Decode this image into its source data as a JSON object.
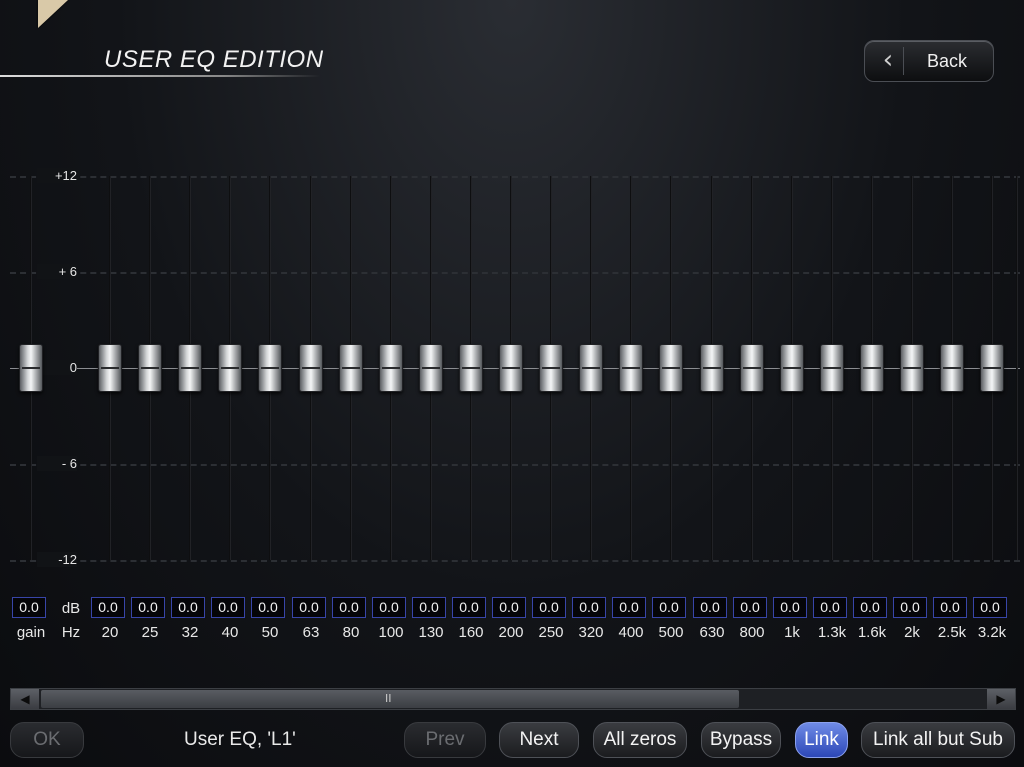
{
  "header": {
    "title": "USER EQ EDITION",
    "back_label": "Back",
    "back_icon": "chevron-left-icon"
  },
  "scale": {
    "unit": "dB",
    "range_db": [
      -12,
      12
    ],
    "labels": [
      "+12",
      "+ 6",
      "0",
      "- 6",
      "-12"
    ]
  },
  "gain": {
    "value": "0.0",
    "label": "gain",
    "level_db": 0
  },
  "freq_unit": "Hz",
  "bands": [
    {
      "freq": "20",
      "value": "0.0",
      "level_db": 0
    },
    {
      "freq": "25",
      "value": "0.0",
      "level_db": 0
    },
    {
      "freq": "32",
      "value": "0.0",
      "level_db": 0
    },
    {
      "freq": "40",
      "value": "0.0",
      "level_db": 0
    },
    {
      "freq": "50",
      "value": "0.0",
      "level_db": 0
    },
    {
      "freq": "63",
      "value": "0.0",
      "level_db": 0
    },
    {
      "freq": "80",
      "value": "0.0",
      "level_db": 0
    },
    {
      "freq": "100",
      "value": "0.0",
      "level_db": 0
    },
    {
      "freq": "130",
      "value": "0.0",
      "level_db": 0
    },
    {
      "freq": "160",
      "value": "0.0",
      "level_db": 0
    },
    {
      "freq": "200",
      "value": "0.0",
      "level_db": 0
    },
    {
      "freq": "250",
      "value": "0.0",
      "level_db": 0
    },
    {
      "freq": "320",
      "value": "0.0",
      "level_db": 0
    },
    {
      "freq": "400",
      "value": "0.0",
      "level_db": 0
    },
    {
      "freq": "500",
      "value": "0.0",
      "level_db": 0
    },
    {
      "freq": "630",
      "value": "0.0",
      "level_db": 0
    },
    {
      "freq": "800",
      "value": "0.0",
      "level_db": 0
    },
    {
      "freq": "1k",
      "value": "0.0",
      "level_db": 0
    },
    {
      "freq": "1.3k",
      "value": "0.0",
      "level_db": 0
    },
    {
      "freq": "1.6k",
      "value": "0.0",
      "level_db": 0
    },
    {
      "freq": "2k",
      "value": "0.0",
      "level_db": 0
    },
    {
      "freq": "2.5k",
      "value": "0.0",
      "level_db": 0
    },
    {
      "freq": "3.2k",
      "value": "0.0",
      "level_db": 0
    }
  ],
  "scrollbar": {
    "left_icon": "arrow-left-icon",
    "right_icon": "arrow-right-icon",
    "grip": "II"
  },
  "footer": {
    "ok_label": "OK",
    "status": "User EQ, 'L1'",
    "prev_label": "Prev",
    "next_label": "Next",
    "all_zeros_label": "All zeros",
    "bypass_label": "Bypass",
    "link_label": "Link",
    "link_all_but_sub_label": "Link all but Sub"
  },
  "colors": {
    "accent_blue": "#3a55c8",
    "value_border": "#3845a8",
    "background": "#121418"
  }
}
